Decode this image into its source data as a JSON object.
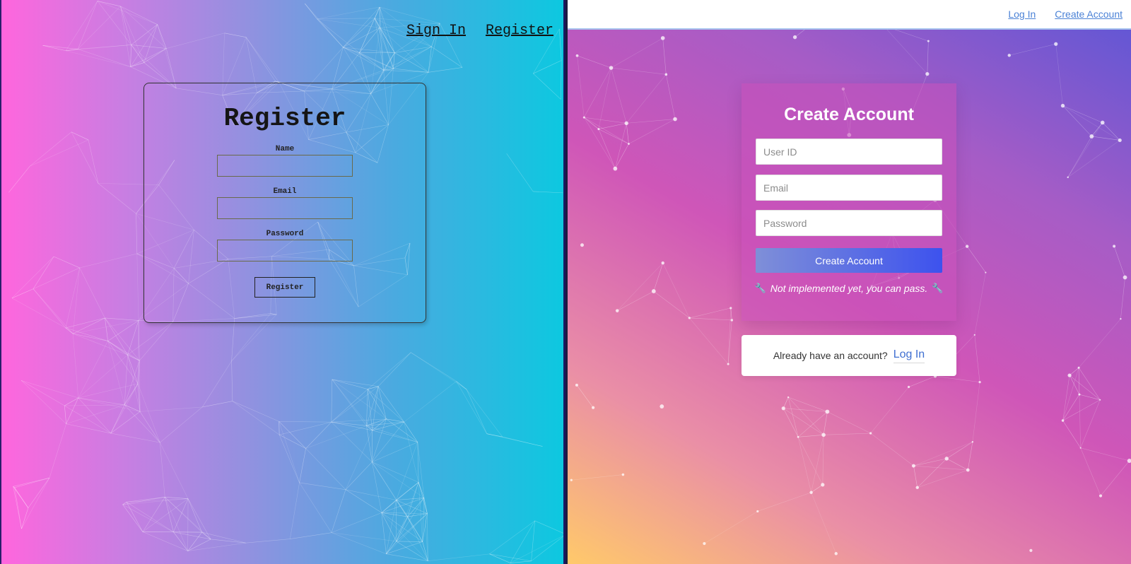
{
  "left": {
    "nav": {
      "sign_in": "Sign In",
      "register": "Register"
    },
    "form": {
      "title": "Register",
      "name_label": "Name",
      "email_label": "Email",
      "password_label": "Password",
      "submit_label": "Register"
    }
  },
  "right": {
    "nav": {
      "log_in": "Log In",
      "create_account": "Create Account"
    },
    "form": {
      "title": "Create Account",
      "user_id_placeholder": "User ID",
      "email_placeholder": "Email",
      "password_placeholder": "Password",
      "submit_label": "Create Account",
      "note": "Not implemented yet, you can pass.",
      "note_icon": "🔧"
    },
    "login": {
      "prompt": "Already have an account?",
      "link": "Log In"
    }
  },
  "colors": {
    "left_gradient": [
      "#ff66dd",
      "#0dc8e0"
    ],
    "right_gradient": [
      "#ffc96a",
      "#cf56b8",
      "#5b56d6"
    ],
    "button_gradient": [
      "#7f8fd8",
      "#3d52ee"
    ],
    "link": "#4b82d6"
  },
  "icons": {
    "left_background": "network-mesh",
    "right_background": "network-mesh",
    "note_icon": "wrench-icon"
  }
}
